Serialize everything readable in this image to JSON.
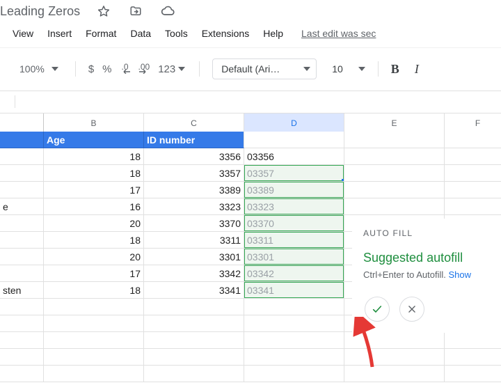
{
  "doc_title": "Leading Zeros",
  "title_icons": {
    "star": "star-icon",
    "move": "move-folder-icon",
    "cloud": "cloud-status-icon"
  },
  "menu": {
    "items": [
      "View",
      "Insert",
      "Format",
      "Data",
      "Tools",
      "Extensions",
      "Help"
    ],
    "last_edit": "Last edit was sec"
  },
  "toolbar": {
    "zoom": "100%",
    "fmt": {
      "currency": "$",
      "percent": "%",
      "dec_dec": ".0",
      "inc_dec": ".00",
      "more": "123"
    },
    "font": "Default (Ari…",
    "size": "10",
    "bold": "B",
    "italic": "I"
  },
  "columns": [
    "B",
    "C",
    "D",
    "E",
    "F"
  ],
  "selected_col": "D",
  "sheet": {
    "header": {
      "A": "",
      "B": "Age",
      "C": "ID number",
      "D": "",
      "E": "",
      "F": ""
    },
    "rows": [
      {
        "A": "",
        "B": "18",
        "C": "3356",
        "D": "03356"
      },
      {
        "A": "",
        "B": "18",
        "C": "3357",
        "D": "03357"
      },
      {
        "A": "",
        "B": "17",
        "C": "3389",
        "D": "03389"
      },
      {
        "A": "e",
        "B": "16",
        "C": "3323",
        "D": "03323"
      },
      {
        "A": "",
        "B": "20",
        "C": "3370",
        "D": "03370"
      },
      {
        "A": "",
        "B": "18",
        "C": "3311",
        "D": "03311"
      },
      {
        "A": "",
        "B": "20",
        "C": "3301",
        "D": "03301"
      },
      {
        "A": "",
        "B": "17",
        "C": "3342",
        "D": "03342"
      },
      {
        "A": "sten",
        "B": "18",
        "C": "3341",
        "D": "03341"
      }
    ]
  },
  "autofill_popup": {
    "title": "AUTO FILL",
    "heading": "Suggested autofill",
    "hint_prefix": "Ctrl+Enter to Autofill. ",
    "hint_link": "Show"
  }
}
